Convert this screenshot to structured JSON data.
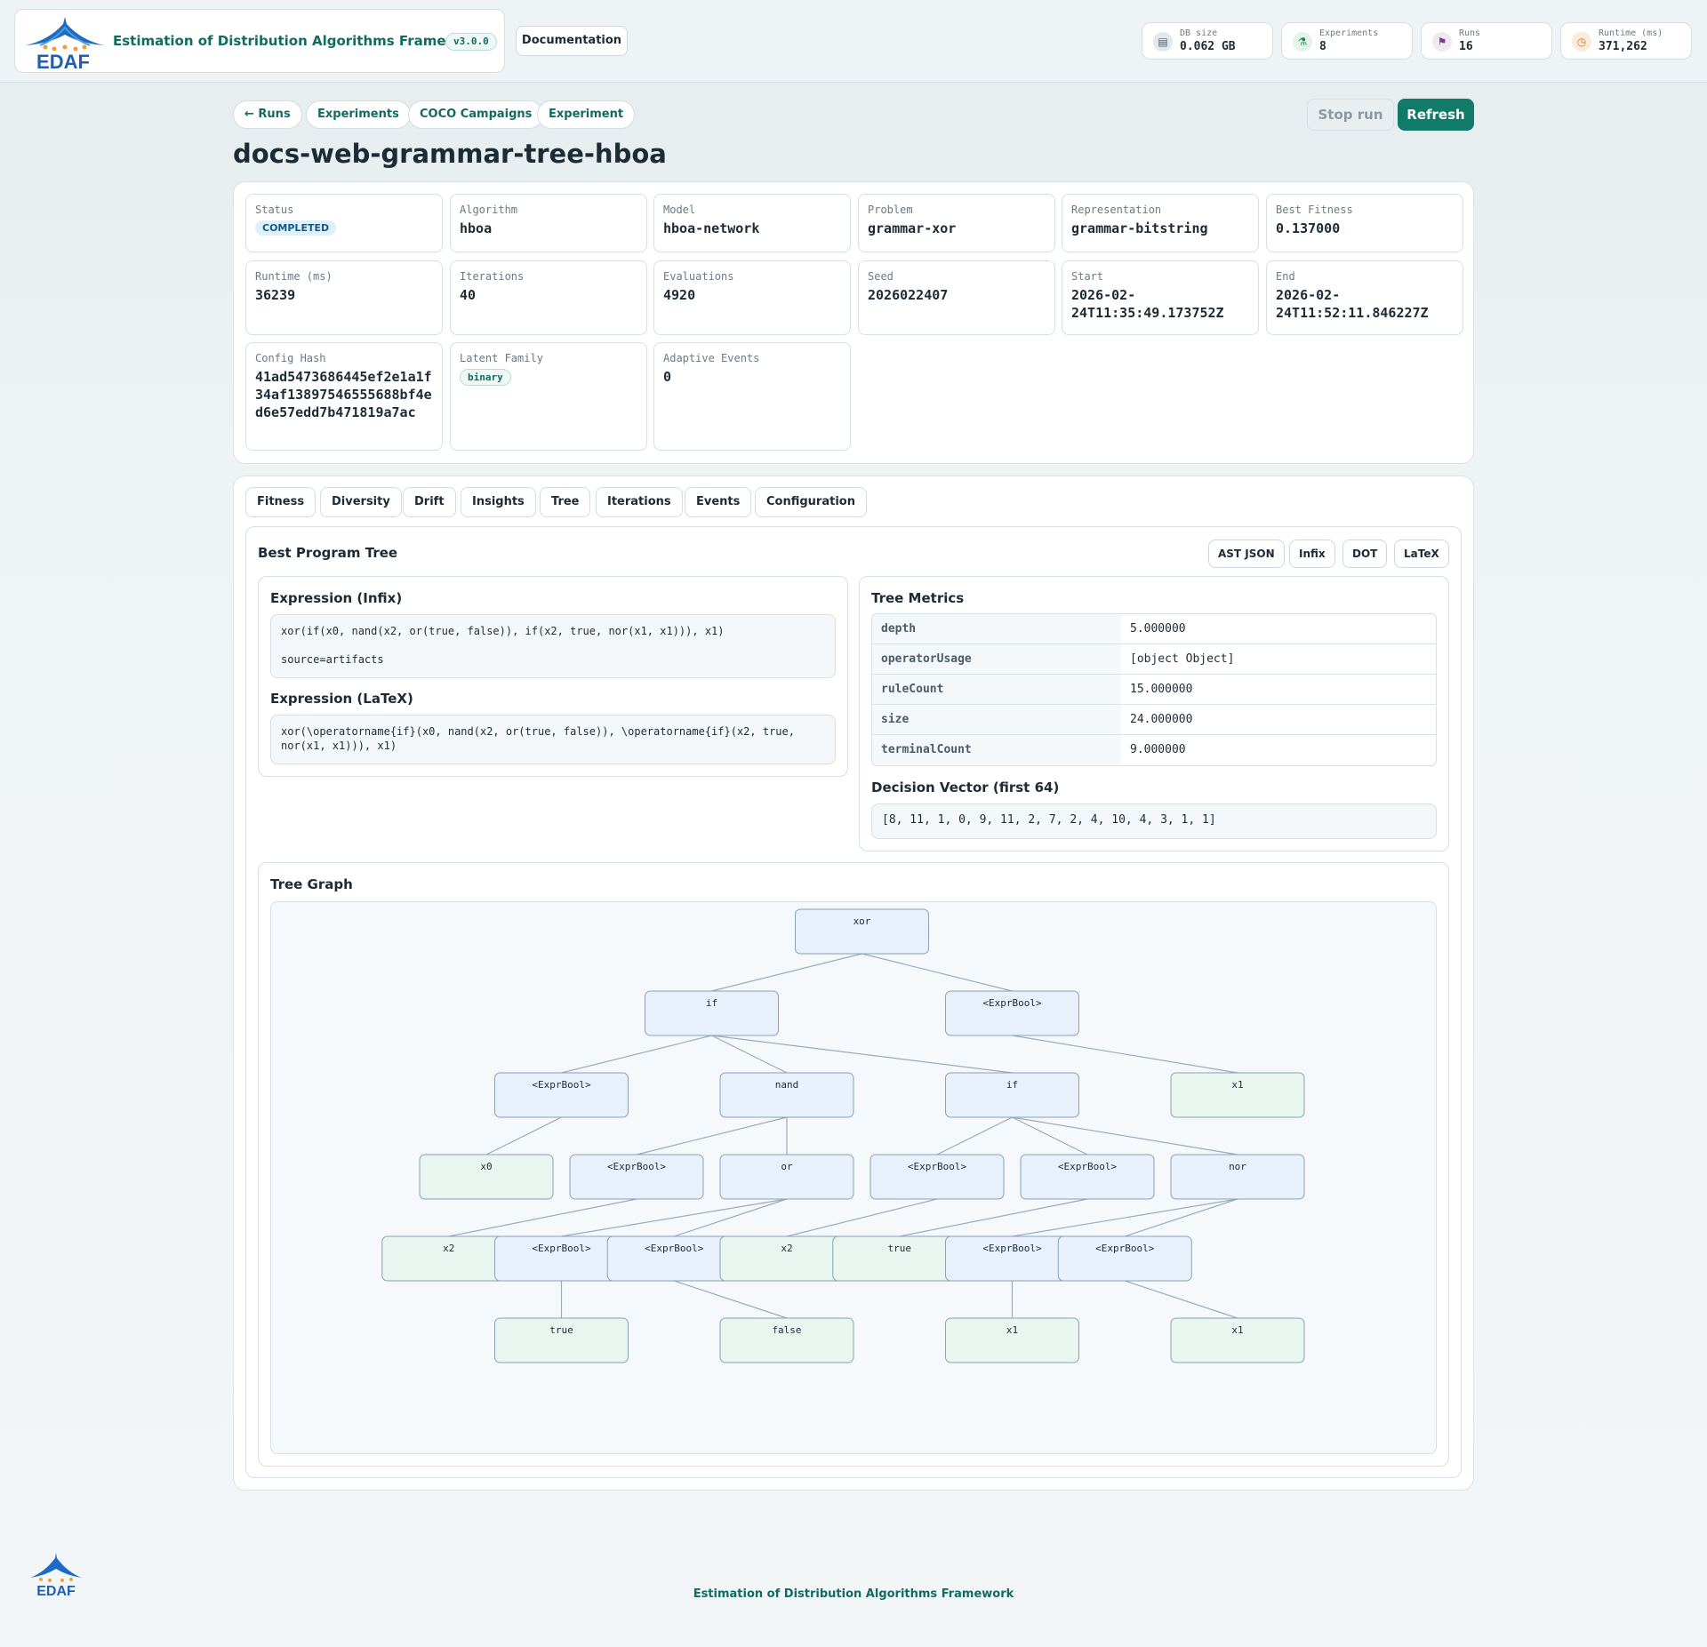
{
  "header": {
    "logo_text": "EDAF",
    "app_title": "Estimation of Distribution Algorithms Framework",
    "version": "v3.0.0",
    "documentation_label": "Documentation",
    "stats": [
      {
        "label": "DB size",
        "value": "0.062 GB",
        "icon": "database-icon"
      },
      {
        "label": "Experiments",
        "value": "8",
        "icon": "flask-icon"
      },
      {
        "label": "Runs",
        "value": "16",
        "icon": "checkered-flag-icon"
      },
      {
        "label": "Runtime (ms)",
        "value": "371,262",
        "icon": "timer-icon"
      }
    ]
  },
  "nav": {
    "back_runs": "← Runs",
    "experiments": "Experiments",
    "coco": "COCO Campaigns",
    "experiment": "Experiment",
    "stop_run": "Stop run",
    "refresh": "Refresh"
  },
  "run": {
    "title": "docs-web-grammar-tree-hboa",
    "fields": {
      "status": {
        "label": "Status",
        "value": "COMPLETED"
      },
      "algorithm": {
        "label": "Algorithm",
        "value": "hboa"
      },
      "model": {
        "label": "Model",
        "value": "hboa-network"
      },
      "problem": {
        "label": "Problem",
        "value": "grammar-xor"
      },
      "representation": {
        "label": "Representation",
        "value": "grammar-bitstring"
      },
      "best_fitness": {
        "label": "Best Fitness",
        "value": "0.137000"
      },
      "runtime": {
        "label": "Runtime (ms)",
        "value": "36239"
      },
      "iterations": {
        "label": "Iterations",
        "value": "40"
      },
      "evaluations": {
        "label": "Evaluations",
        "value": "4920"
      },
      "seed": {
        "label": "Seed",
        "value": "2026022407"
      },
      "start": {
        "label": "Start",
        "value": "2026-02-24T11:35:49.173752Z"
      },
      "end": {
        "label": "End",
        "value": "2026-02-24T11:52:11.846227Z"
      },
      "config_hash": {
        "label": "Config Hash",
        "value": "41ad5473686445ef2e1a1f34af13897546555688bf4ed6e57edd7b471819a7ac"
      },
      "latent_family": {
        "label": "Latent Family",
        "value": "binary"
      },
      "adaptive_events": {
        "label": "Adaptive Events",
        "value": "0"
      }
    }
  },
  "tabs": [
    "Fitness",
    "Diversity",
    "Drift",
    "Insights",
    "Tree",
    "Iterations",
    "Events",
    "Configuration"
  ],
  "tree_panel": {
    "title": "Best Program Tree",
    "formats": [
      "AST JSON",
      "Infix",
      "DOT",
      "LaTeX"
    ],
    "infix_title": "Expression (Infix)",
    "infix": "xor(if(x0, nand(x2, or(true, false)), if(x2, true, nor(x1, x1))), x1)",
    "source": "source=artifacts",
    "latex_title": "Expression (LaTeX)",
    "latex": "xor(\\operatorname{if}(x0, nand(x2, or(true, false)), \\operatorname{if}(x2, true, nor(x1, x1))), x1)",
    "metrics_title": "Tree Metrics",
    "metrics": [
      {
        "key": "depth",
        "value": "5.000000"
      },
      {
        "key": "operatorUsage",
        "value": "[object Object]"
      },
      {
        "key": "ruleCount",
        "value": "15.000000"
      },
      {
        "key": "size",
        "value": "24.000000"
      },
      {
        "key": "terminalCount",
        "value": "9.000000"
      }
    ],
    "decision_title": "Decision Vector (first 64)",
    "decision_vector": "[8, 11, 1, 0, 9, 11, 2, 7, 2, 4, 10, 4, 3, 1, 1]",
    "graph_title": "Tree Graph"
  },
  "tree_graph": {
    "node_fill_internal": "#e8f0fc",
    "node_fill_leaf": "#e8f6ef",
    "node_stroke": "#8aa0b4",
    "edge_color": "#9aabbb",
    "nodes": [
      {
        "id": "n0",
        "label": "xor",
        "kind": "internal",
        "level": 0,
        "slot": 7
      },
      {
        "id": "n1",
        "label": "if",
        "kind": "internal",
        "level": 1,
        "slot": 5
      },
      {
        "id": "n2",
        "label": "<ExprBool>",
        "kind": "internal",
        "level": 1,
        "slot": 9
      },
      {
        "id": "n3",
        "label": "<ExprBool>",
        "kind": "internal",
        "level": 2,
        "slot": 3
      },
      {
        "id": "n4",
        "label": "nand",
        "kind": "internal",
        "level": 2,
        "slot": 6
      },
      {
        "id": "n5",
        "label": "if",
        "kind": "internal",
        "level": 2,
        "slot": 9
      },
      {
        "id": "n6",
        "label": "x1",
        "kind": "leaf",
        "level": 2,
        "slot": 12
      },
      {
        "id": "n7",
        "label": "x0",
        "kind": "leaf",
        "level": 3,
        "slot": 2
      },
      {
        "id": "n8",
        "label": "<ExprBool>",
        "kind": "internal",
        "level": 3,
        "slot": 4
      },
      {
        "id": "n9",
        "label": "or",
        "kind": "internal",
        "level": 3,
        "slot": 6
      },
      {
        "id": "n10",
        "label": "<ExprBool>",
        "kind": "internal",
        "level": 3,
        "slot": 8
      },
      {
        "id": "n11",
        "label": "<ExprBool>",
        "kind": "internal",
        "level": 3,
        "slot": 10
      },
      {
        "id": "n12",
        "label": "nor",
        "kind": "internal",
        "level": 3,
        "slot": 12
      },
      {
        "id": "n13",
        "label": "x2",
        "kind": "leaf",
        "level": 4,
        "slot": 1.5
      },
      {
        "id": "n14",
        "label": "<ExprBool>",
        "kind": "internal",
        "level": 4,
        "slot": 3
      },
      {
        "id": "n15",
        "label": "<ExprBool>",
        "kind": "internal",
        "level": 4,
        "slot": 4.5
      },
      {
        "id": "n16",
        "label": "x2",
        "kind": "leaf",
        "level": 4,
        "slot": 6
      },
      {
        "id": "n17",
        "label": "true",
        "kind": "leaf",
        "level": 4,
        "slot": 7.5
      },
      {
        "id": "n18",
        "label": "<ExprBool>",
        "kind": "internal",
        "level": 4,
        "slot": 9
      },
      {
        "id": "n19",
        "label": "<ExprBool>",
        "kind": "internal",
        "level": 4,
        "slot": 10.5
      },
      {
        "id": "n20",
        "label": "true",
        "kind": "leaf",
        "level": 5,
        "slot": 3
      },
      {
        "id": "n21",
        "label": "false",
        "kind": "leaf",
        "level": 5,
        "slot": 6
      },
      {
        "id": "n22",
        "label": "x1",
        "kind": "leaf",
        "level": 5,
        "slot": 9
      },
      {
        "id": "n23",
        "label": "x1",
        "kind": "leaf",
        "level": 5,
        "slot": 12
      }
    ],
    "edges": [
      [
        "n0",
        "n1"
      ],
      [
        "n0",
        "n2"
      ],
      [
        "n1",
        "n3"
      ],
      [
        "n1",
        "n4"
      ],
      [
        "n1",
        "n5"
      ],
      [
        "n2",
        "n6"
      ],
      [
        "n3",
        "n7"
      ],
      [
        "n4",
        "n8"
      ],
      [
        "n4",
        "n9"
      ],
      [
        "n5",
        "n10"
      ],
      [
        "n5",
        "n11"
      ],
      [
        "n5",
        "n12"
      ],
      [
        "n8",
        "n13"
      ],
      [
        "n9",
        "n14"
      ],
      [
        "n9",
        "n15"
      ],
      [
        "n10",
        "n16"
      ],
      [
        "n11",
        "n17"
      ],
      [
        "n12",
        "n18"
      ],
      [
        "n12",
        "n19"
      ],
      [
        "n14",
        "n20"
      ],
      [
        "n15",
        "n21"
      ],
      [
        "n18",
        "n22"
      ],
      [
        "n19",
        "n23"
      ]
    ]
  },
  "footer": {
    "title": "Estimation of Distribution Algorithms Framework",
    "logo_text": "EDAF"
  }
}
